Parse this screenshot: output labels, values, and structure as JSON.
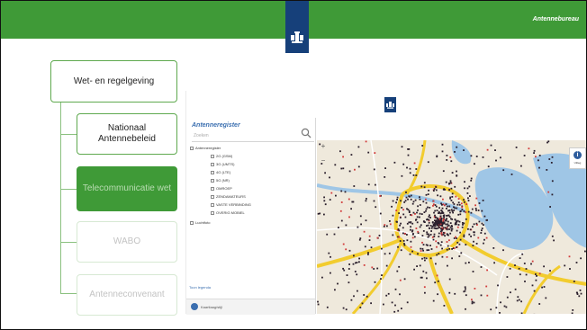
{
  "header": {
    "brand": "Antennebureau"
  },
  "nav": {
    "items": [
      {
        "label": "Wet- en regelgeving",
        "state": "normal"
      },
      {
        "label": "Nationaal Antennebeleid",
        "state": "normal"
      },
      {
        "label": "Telecommunicatie wet",
        "state": "active"
      },
      {
        "label": "WABO",
        "state": "faded"
      },
      {
        "label": "Antenneconvenant",
        "state": "faded"
      }
    ]
  },
  "screenshot": {
    "panel_title": "Antenneregister",
    "search": {
      "placeholder": "Zoeken"
    },
    "layers": {
      "root": "Antenneregister",
      "children": [
        "2G (GSM)",
        "3G (UMTS)",
        "4G (LTE)",
        "5G (NR)",
        "OMROEP",
        "ZENDAMATEURS",
        "VASTE VERBINDING",
        "OVERIG MOBIEL"
      ],
      "other": "Luchtfoto"
    },
    "legend_link": "Toon legenda",
    "footer_text": "Kaartlaag/stijl",
    "map": {
      "zoom_in": "+",
      "zoom_out": "−",
      "info_label": "Uitleg"
    }
  },
  "colors": {
    "brand_green": "#3f9a37",
    "logo_blue": "#16407a",
    "water": "#9fc6e6",
    "highway": "#f2cc2e",
    "marker_dark": "#2a1e2c",
    "marker_red": "#d23a3a"
  }
}
